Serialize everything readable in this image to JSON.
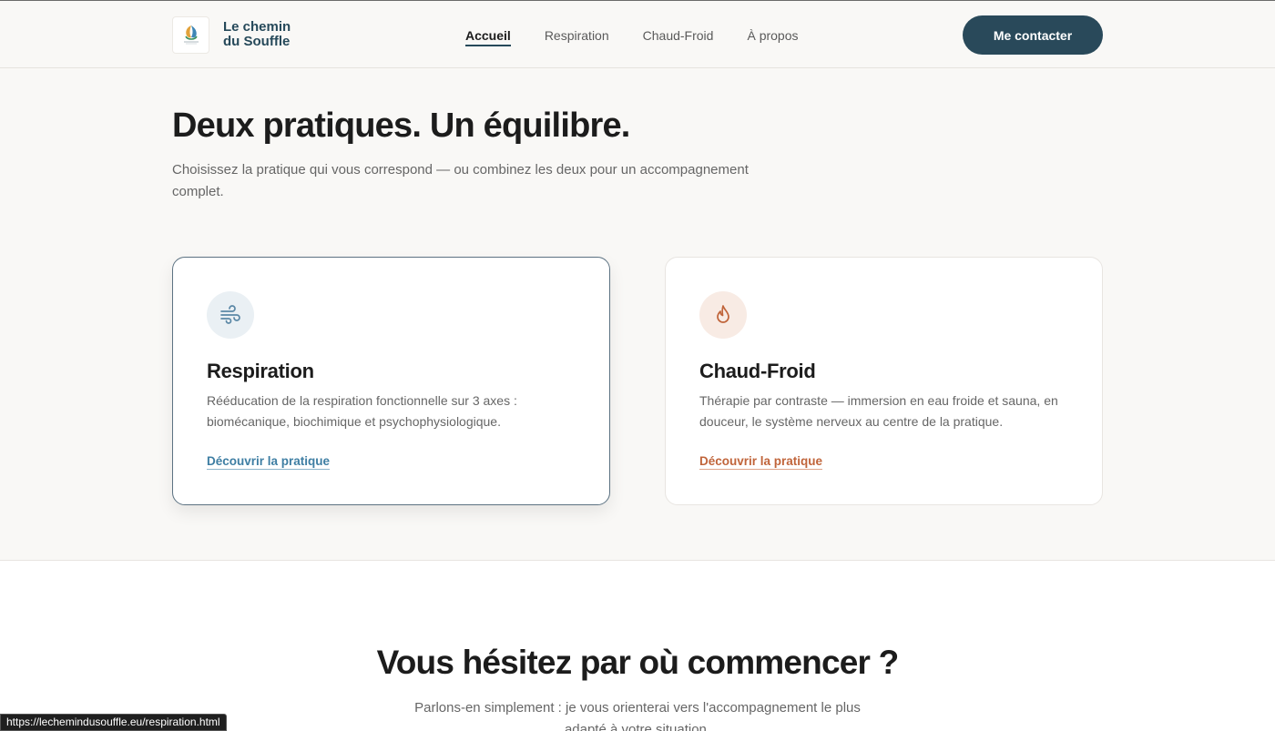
{
  "brand": {
    "name_line1": "Le chemin",
    "name_line2": "du Souffle"
  },
  "nav": {
    "items": [
      {
        "label": "Accueil",
        "active": true
      },
      {
        "label": "Respiration",
        "active": false
      },
      {
        "label": "Chaud-Froid",
        "active": false
      },
      {
        "label": "À propos",
        "active": false
      }
    ]
  },
  "header": {
    "cta_label": "Me contacter"
  },
  "practices": {
    "title": "Deux pratiques. Un équilibre.",
    "lead": "Choisissez la pratique qui vous correspond — ou combinez les deux pour un accompagnement complet.",
    "cards": [
      {
        "icon": "wind-icon",
        "title": "Respiration",
        "description": "Rééducation de la respiration fonctionnelle sur 3 axes : biomécanique, biochimique et psychophysiologique.",
        "link": "Découvrir la pratique",
        "accent": "#3e7ea3"
      },
      {
        "icon": "flame-icon",
        "title": "Chaud-Froid",
        "description": "Thérapie par contraste — immersion en eau froide et sauna, en douceur, le système nerveux au centre de la pratique.",
        "link": "Découvrir la pratique",
        "accent": "#c0643a"
      }
    ]
  },
  "hesitate": {
    "title": "Vous hésitez par où commencer ?",
    "lead": "Parlons-en simplement : je vous orienterai vers l'accompagnement le plus adapté à votre situation."
  },
  "status_url": "https://lechemindusouffle.eu/respiration.html",
  "colors": {
    "primary": "#29495a",
    "respiration": "#3e7ea3",
    "chaud_froid": "#c0643a"
  }
}
